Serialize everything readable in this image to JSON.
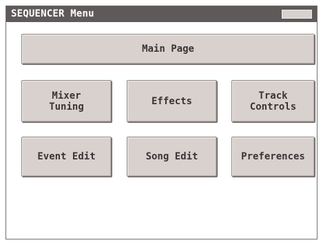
{
  "window": {
    "title": "SEQUENCER Menu"
  },
  "buttons": {
    "main_page": "Main Page",
    "mixer_tuning": "Mixer\nTuning",
    "effects": "Effects",
    "track_controls": "Track Controls",
    "event_edit": "Event Edit",
    "song_edit": "Song Edit",
    "preferences": "Preferences"
  },
  "colors": {
    "titlebar": "#5f5a59",
    "button_face": "#d8d1ce",
    "button_border": "#8a8280",
    "text_dark": "#3a3535"
  }
}
